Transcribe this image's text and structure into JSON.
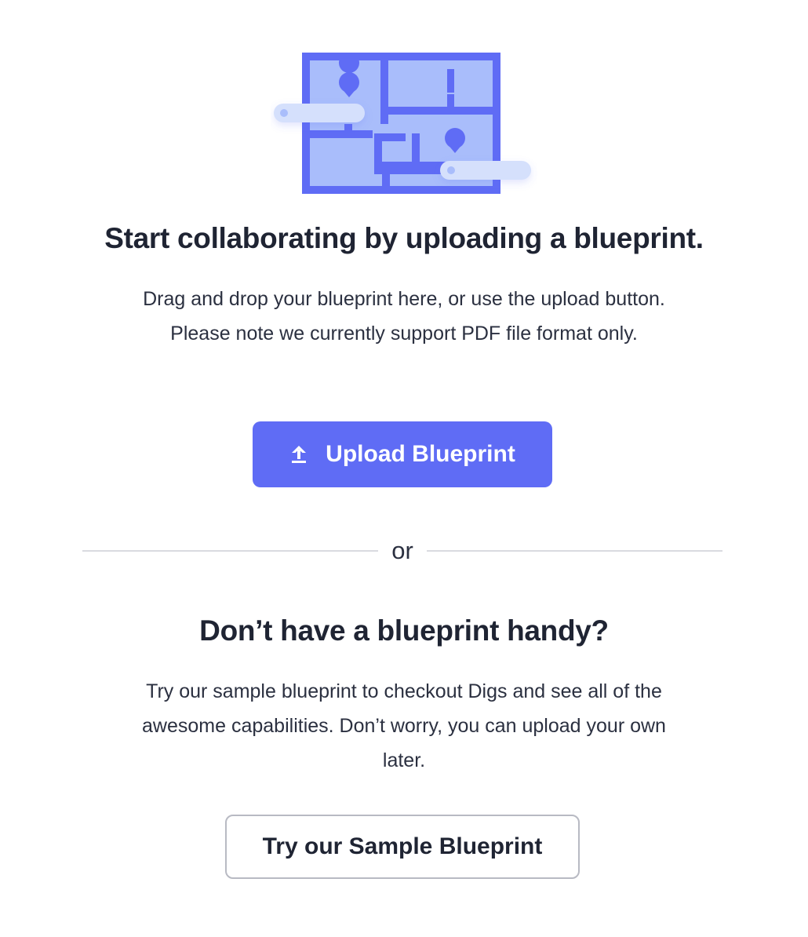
{
  "hero": {
    "illustration_icon": "floorplan-illustration",
    "title": "Start collaborating by uploading a blueprint.",
    "description": "Drag and drop your blueprint here, or use the upload button. Please note we currently support PDF file format only."
  },
  "upload": {
    "label": "Upload Blueprint",
    "icon": "upload-icon"
  },
  "divider": {
    "label": "or"
  },
  "sample": {
    "title": "Don’t have a blueprint handy?",
    "description": "Try our sample blueprint to checkout Digs and see all of the awesome capabilities. Don’t worry, you can upload your own later.",
    "button_label": "Try our Sample Blueprint"
  },
  "colors": {
    "accent": "#5f6cf5",
    "text": "#1f2433",
    "illustration_light": "#a9bdfb",
    "illustration_pill": "#d5e0fc",
    "divider": "#d9dbe0",
    "button_border": "#b8bac3"
  }
}
